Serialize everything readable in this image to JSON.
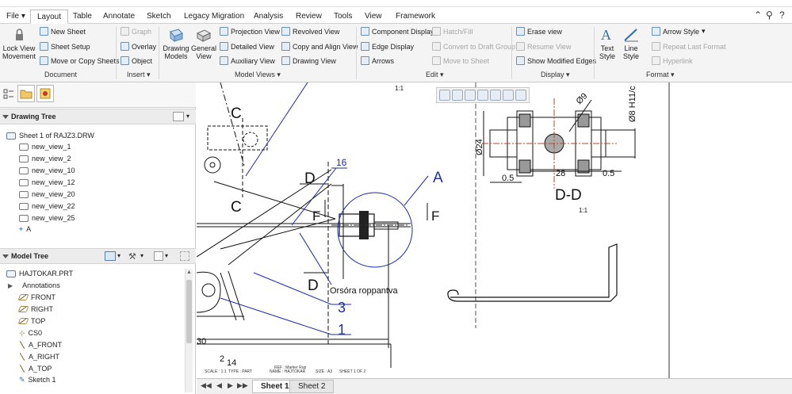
{
  "tabs": [
    "File",
    "Layout",
    "Table",
    "Annotate",
    "Sketch",
    "Legacy Migration",
    "Analysis",
    "Review",
    "Tools",
    "View",
    "Framework"
  ],
  "active_tab": "Layout",
  "ribbon": {
    "document": {
      "label": "Document",
      "lock_view": [
        "Lock View",
        "Movement"
      ],
      "new_sheet": "New Sheet",
      "sheet_setup": "Sheet Setup",
      "move_copy": "Move or Copy Sheets"
    },
    "insert": {
      "label": "Insert",
      "graph": "Graph",
      "overlay": "Overlay",
      "object": "Object"
    },
    "model_views": {
      "label": "Model Views",
      "drawing_models": [
        "Drawing",
        "Models"
      ],
      "general_view": [
        "General",
        "View"
      ],
      "projection_view": "Projection View",
      "detailed_view": "Detailed View",
      "auxiliary_view": "Auxiliary View",
      "revolved_view": "Revolved View",
      "copy_align": "Copy and Align View",
      "drawing_view": "Drawing View"
    },
    "edit": {
      "label": "Edit",
      "component_display": "Component Display",
      "edge_display": "Edge Display",
      "arrows": "Arrows",
      "hatch_fill": "Hatch/Fill",
      "convert_draft": "Convert to Draft Group",
      "move_sheet": "Move to Sheet"
    },
    "display": {
      "label": "Display",
      "erase_view": "Erase view",
      "resume_view": "Resume View",
      "show_modified": "Show Modified Edges"
    },
    "format": {
      "label": "Format",
      "text_style": [
        "Text",
        "Style"
      ],
      "line_style": [
        "Line",
        "Style"
      ],
      "arrow_style": "Arrow Style",
      "repeat_last": "Repeat Last Format",
      "hyperlink": "Hyperlink"
    }
  },
  "drawing_tree": {
    "title": "Drawing Tree",
    "root": "Sheet 1 of RAJZ3.DRW",
    "items": [
      "new_view_1",
      "new_view_2",
      "new_view_10",
      "new_view_12",
      "new_view_20",
      "new_view_22",
      "new_view_25",
      "A"
    ]
  },
  "model_tree": {
    "title": "Model Tree",
    "root": "HAJTOKAR.PRT",
    "items": [
      "Annotations",
      "FRONT",
      "RIGHT",
      "TOP",
      "CS0",
      "A_FRONT",
      "A_RIGHT",
      "A_TOP",
      "Sketch 1"
    ]
  },
  "drawing": {
    "scale_top": "1:1",
    "label_c1": "C",
    "label_c2": "C",
    "label_d1": "D",
    "label_d2": "D",
    "label_16": "16",
    "label_a": "A",
    "label_f1": "F",
    "label_f2": "F",
    "label_orsora": "Orsóra roppantva",
    "label_3": "3",
    "label_1": "1",
    "label_30": "30",
    "label_2": "2",
    "label_14": "14",
    "dd_title": "D-D",
    "dd_scale": "1:1",
    "dim_phi9": "Ø9",
    "dim_phi24": "Ø24",
    "dim_phi8": "Ø8 H11/c",
    "dim_28": "28",
    "dim_05a": "0.5",
    "dim_05b": "0.5",
    "titleblock": [
      "REF : Marker Rup",
      "SCALE : 1:1",
      "TYPE : PART",
      "NAME : HAJTOKAR",
      "SIZE : A3",
      "SHEET 1 OF 2"
    ]
  },
  "sheets": [
    "Sheet 1",
    "Sheet 2"
  ],
  "active_sheet": "Sheet 1",
  "colors": {
    "annot_blue": "#1a2ca8",
    "line": "#111111",
    "accent": "#2f6fb0"
  }
}
